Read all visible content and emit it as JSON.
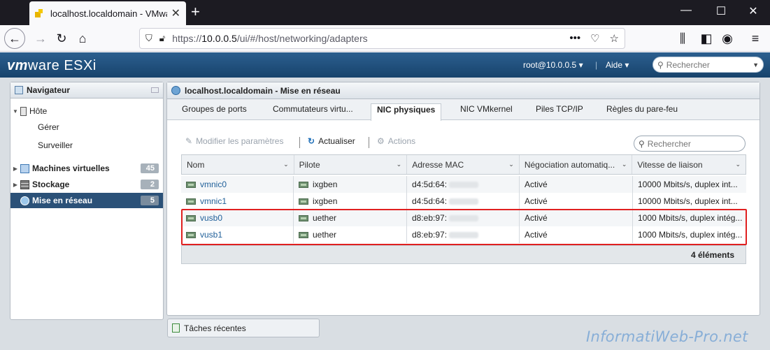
{
  "browser": {
    "tab_title": "localhost.localdomain - VMwar",
    "url_host": "10.0.0.5",
    "url_prefix": "https://",
    "url_path": "/ui/#/host/networking/adapters",
    "overflow": "•••"
  },
  "esxi": {
    "logo_vm": "vm",
    "logo_rest": "ware ESXi",
    "user_menu": "root@10.0.0.5 ▾",
    "help_menu": "Aide ▾",
    "search_placeholder": "Rechercher"
  },
  "navigator": {
    "title": "Navigateur",
    "host": {
      "label": "Hôte",
      "children": [
        "Gérer",
        "Surveiller"
      ]
    },
    "items": [
      {
        "label": "Machines virtuelles",
        "count": "45"
      },
      {
        "label": "Stockage",
        "count": "2"
      },
      {
        "label": "Mise en réseau",
        "count": "5"
      }
    ]
  },
  "content": {
    "title": "localhost.localdomain - Mise en réseau",
    "tabs": [
      "Groupes de ports",
      "Commutateurs virtu...",
      "NIC physiques",
      "NIC VMkernel",
      "Piles TCP/IP",
      "Règles du pare-feu"
    ],
    "active_tab": "NIC physiques",
    "toolbar": {
      "edit": "Modifier les paramètres",
      "refresh": "Actualiser",
      "actions": "Actions"
    },
    "search_placeholder": "Rechercher",
    "columns": [
      "Nom",
      "Pilote",
      "Adresse MAC",
      "Négociation automatiq...",
      "Vitesse de liaison"
    ],
    "rows": [
      {
        "name": "vmnic0",
        "driver": "ixgben",
        "mac": "d4:5d:64:",
        "autoneg": "Activé",
        "speed": "10000 Mbits/s, duplex int..."
      },
      {
        "name": "vmnic1",
        "driver": "ixgben",
        "mac": "d4:5d:64:",
        "autoneg": "Activé",
        "speed": "10000 Mbits/s, duplex int..."
      },
      {
        "name": "vusb0",
        "driver": "uether",
        "mac": "d8:eb:97:",
        "autoneg": "Activé",
        "speed": "1000 Mbits/s, duplex intég..."
      },
      {
        "name": "vusb1",
        "driver": "uether",
        "mac": "d8:eb:97:",
        "autoneg": "Activé",
        "speed": "1000 Mbits/s, duplex intég..."
      }
    ],
    "footer": "4 éléments"
  },
  "recent_tasks": "Tâches récentes",
  "watermark": "InformatiWeb-Pro.net"
}
